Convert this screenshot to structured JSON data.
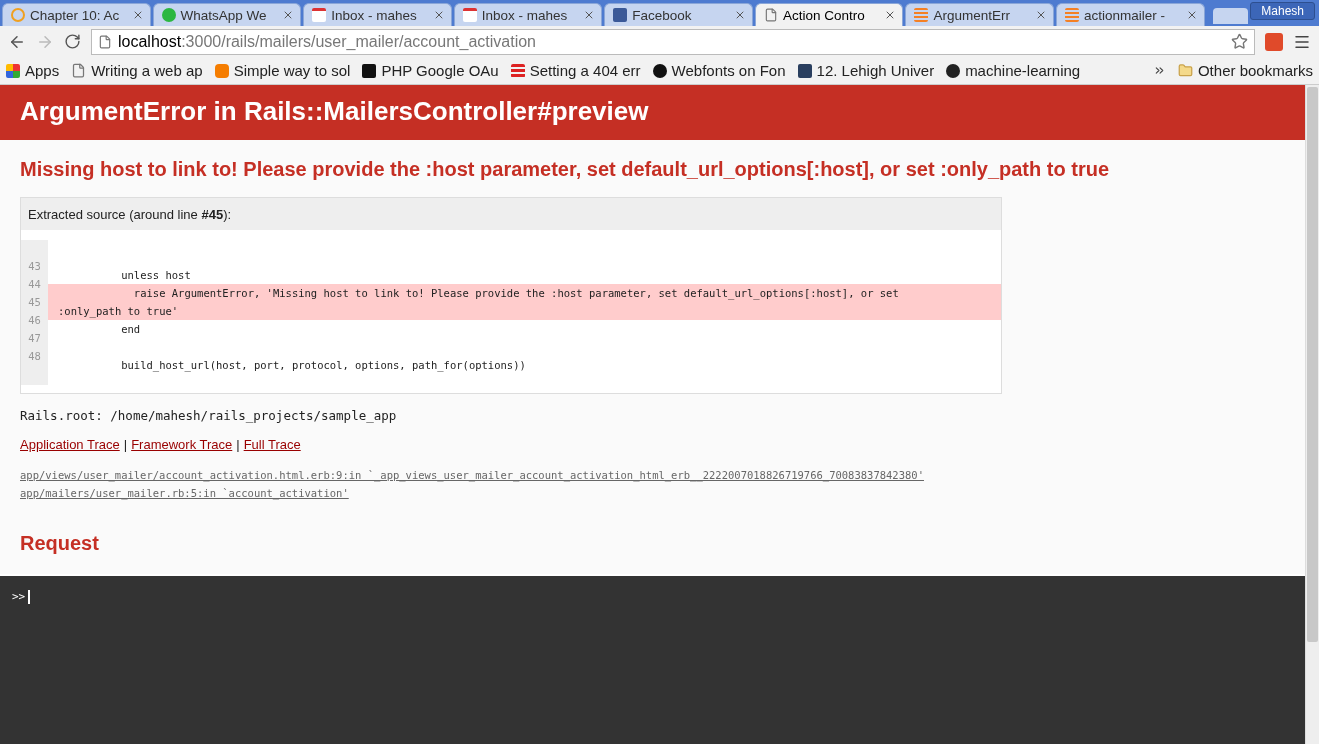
{
  "tabs": [
    {
      "title": "Chapter 10: Ac",
      "selected": false
    },
    {
      "title": "WhatsApp We",
      "selected": false
    },
    {
      "title": "Inbox - mahes",
      "selected": false
    },
    {
      "title": "Inbox - mahes",
      "selected": false
    },
    {
      "title": "Facebook",
      "selected": false
    },
    {
      "title": "Action Contro",
      "selected": true
    },
    {
      "title": "ArgumentErr",
      "selected": false
    },
    {
      "title": "actionmailer -",
      "selected": false
    }
  ],
  "profile": "Mahesh",
  "address": {
    "host": "localhost",
    "path": ":3000/rails/mailers/user_mailer/account_activation"
  },
  "bookmarks": [
    "Apps",
    "Writing a web ap",
    "Simple way to sol",
    "PHP Google OAu",
    "Setting a 404 err",
    "Webfonts on Fon",
    "12. Lehigh Univer",
    "machine-learning"
  ],
  "other_bookmarks": "Other bookmarks",
  "header": "ArgumentError in Rails::MailersController#preview",
  "message": "Missing host to link to! Please provide the :host parameter, set default_url_options[:host], or set :only_path to true",
  "source": {
    "caption": "Extracted source (around line **#45**):",
    "line_numbers": [
      "43",
      "44",
      "45",
      "46",
      "47",
      "48"
    ],
    "lines": [
      {
        "highlighted": false
      },
      {
        "text": "          unless host",
        "highlighted": false
      },
      {
        "text": "            raise ArgumentError, 'Missing host to link to! Please provide the :host parameter, set default_url_options[:host], or set :only_path to true'",
        "highlighted": true
      },
      {
        "text": "          end",
        "highlighted": false
      },
      {
        "highlighted": false
      },
      {
        "text": "          build_host_url(host, port, protocol, options, path_for(options))",
        "highlighted": false
      }
    ]
  },
  "rails_root": "Rails.root: /home/mahesh/rails_projects/sample_app",
  "trace_links": [
    "Application Trace",
    "Framework Trace",
    "Full Trace"
  ],
  "trace_separator": "|",
  "trace_lines": [
    "app/views/user_mailer/account_activation.html.erb:9:in `_app_views_user_mailer_account_activation_html_erb__2222007018826719766_70083837842380'",
    "app/mailers/user_mailer.rb:5:in `account_activation'"
  ],
  "request_heading": "Request",
  "console_prompt": ">>"
}
